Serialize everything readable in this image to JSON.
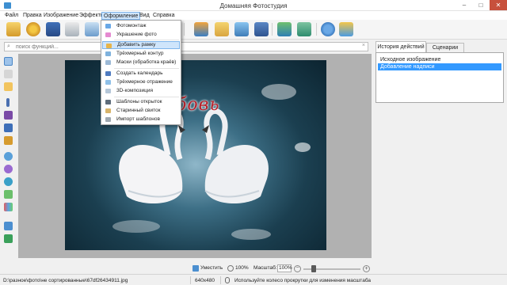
{
  "window": {
    "title": "Домашняя Фотостудия",
    "minimize": "–",
    "maximize": "□",
    "close": "✕"
  },
  "menu": [
    {
      "label": "Файл"
    },
    {
      "label": "Правка"
    },
    {
      "label": "Изображение"
    },
    {
      "label": "Эффекты"
    },
    {
      "label": "Оформление",
      "active": true
    },
    {
      "label": "Вид"
    },
    {
      "label": "Справка"
    }
  ],
  "toolbar": {
    "icons": [
      "open-folder-icon",
      "color-palette-icon",
      "save-icon",
      "print-icon",
      "image-icon",
      "frame-icon",
      "layers-icon",
      "photo-icon",
      "calendar-icon",
      "fit-icon",
      "actual-size-icon",
      "help-icon",
      "package-icon"
    ]
  },
  "search": {
    "placeholder": "поиск функций...",
    "value": ""
  },
  "dropdown": {
    "items": [
      {
        "label": "Фотомонтаж",
        "icon": "montage-icon"
      },
      {
        "label": "Украшение фото",
        "icon": "decoration-icon"
      },
      {
        "label": "Добавить рамку",
        "icon": "frame-add-icon",
        "highlighted": true
      },
      {
        "label": "Трёхмерный контур",
        "icon": "contour-icon"
      },
      {
        "label": "Маски (обработка краёв)",
        "icon": "mask-icon"
      },
      {
        "label": "Создать календарь",
        "icon": "calendar-icon"
      },
      {
        "label": "Трёхмерное отражение",
        "icon": "reflection-icon"
      },
      {
        "label": "3D-композиция",
        "icon": "composition-icon"
      },
      {
        "label": "Шаблоны открыток",
        "icon": "postcard-icon"
      },
      {
        "label": "Старинный свиток",
        "icon": "scroll-icon"
      },
      {
        "label": "Импорт шаблонов",
        "icon": "import-icon"
      }
    ]
  },
  "photo": {
    "caption": "бовь"
  },
  "right_panel": {
    "tabs": [
      {
        "label": "История действий",
        "active": true
      },
      {
        "label": "Сценарии"
      }
    ],
    "history": [
      {
        "label": "Исходное изображение"
      },
      {
        "label": "Добавление надписи",
        "selected": true
      }
    ]
  },
  "zoom_bar": {
    "fit_label": "Уместить",
    "zoom_label": "100%",
    "scale_label": "Масштаб:",
    "scale_value": "100%",
    "minus": "−",
    "plus": "+"
  },
  "status": {
    "path": "D:\\разное\\фото\\не сортированные\\67df26434911.jpg",
    "dimensions": "640x480",
    "hint": "Используйте колесо прокрутки для изменения масштаба"
  },
  "colors": {
    "menu_highlight": "#cfe5fb",
    "selection": "#3399ff",
    "close_button": "#c7503c",
    "caption_red": "#b8202a"
  }
}
